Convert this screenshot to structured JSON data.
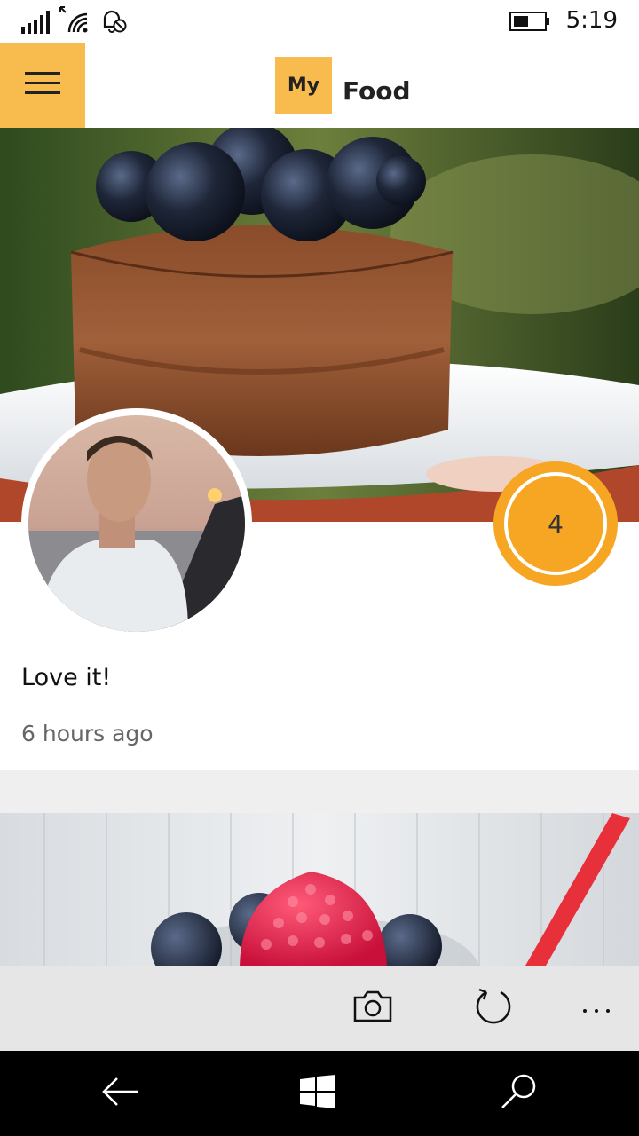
{
  "status_bar": {
    "time": "5:19",
    "icons": [
      "signal-icon",
      "wifi-icon",
      "quiet-hours-icon",
      "battery-icon"
    ]
  },
  "header": {
    "logo_text_box": "My",
    "logo_text": "Food",
    "menu_icon": "hamburger-icon",
    "accent_color": "#F8BB4E"
  },
  "feed": {
    "posts": [
      {
        "image": "chocolate-cake-with-blueberries",
        "avatar": "user-avatar",
        "likes": "4",
        "comment": "Love it!",
        "timestamp": "6 hours ago"
      },
      {
        "image": "smoothie-with-raspberry-and-blueberries"
      }
    ]
  },
  "app_bar": {
    "buttons": [
      "camera-icon",
      "refresh-icon",
      "more-icon"
    ],
    "more_label": "..."
  },
  "nav_bar": {
    "buttons": [
      "back-icon",
      "windows-start-icon",
      "search-icon"
    ]
  },
  "colors": {
    "like_badge": "#F6A623",
    "app_bar_bg": "#e6e6e6",
    "nav_bar_bg": "#000000"
  }
}
